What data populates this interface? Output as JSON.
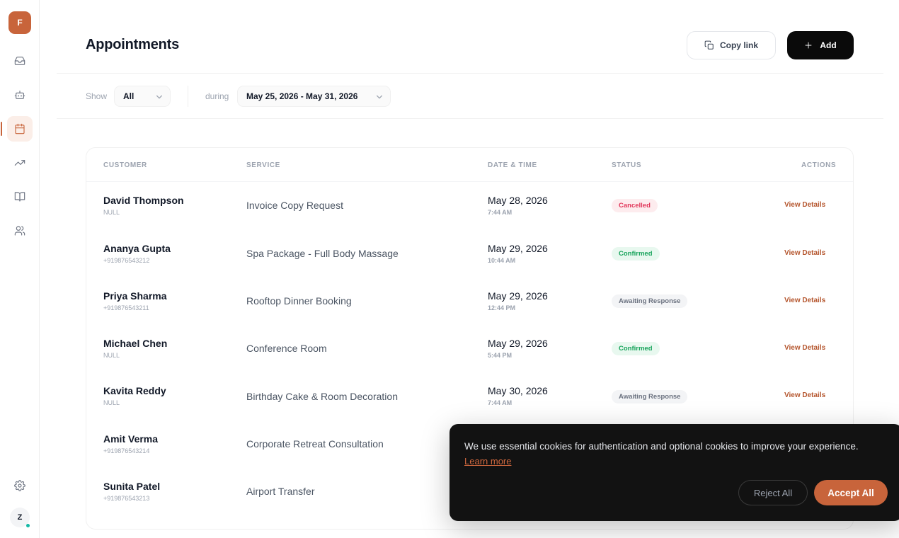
{
  "sidebar": {
    "logo_letter": "F",
    "items": [
      {
        "name": "inbox",
        "icon": "inbox-icon"
      },
      {
        "name": "bot",
        "icon": "bot-icon"
      },
      {
        "name": "appointments",
        "icon": "calendar-icon",
        "active": true
      },
      {
        "name": "analytics",
        "icon": "trending-up-icon"
      },
      {
        "name": "knowledge",
        "icon": "book-icon"
      },
      {
        "name": "users",
        "icon": "users-icon"
      }
    ],
    "settings_icon": "gear-icon",
    "user_initial": "Z"
  },
  "header": {
    "title": "Appointments",
    "copy_link_label": "Copy link",
    "add_label": "Add"
  },
  "filters": {
    "show_label": "Show",
    "show_value": "All",
    "during_label": "during",
    "date_range": "May 25, 2026 - May 31, 2026"
  },
  "table": {
    "columns": [
      "CUSTOMER",
      "SERVICE",
      "DATE & TIME",
      "STATUS",
      "ACTIONS"
    ],
    "rows": [
      {
        "name": "David Thompson",
        "phone": "NULL",
        "service": "Invoice Copy Request",
        "date": "May 28, 2026",
        "time": "7:44 AM",
        "status": "Cancelled",
        "status_type": "cancelled",
        "action": "View Details"
      },
      {
        "name": "Ananya Gupta",
        "phone": "+919876543212",
        "service": "Spa Package - Full Body Massage",
        "date": "May 29, 2026",
        "time": "10:44 AM",
        "status": "Confirmed",
        "status_type": "confirmed",
        "action": "View Details"
      },
      {
        "name": "Priya Sharma",
        "phone": "+919876543211",
        "service": "Rooftop Dinner Booking",
        "date": "May 29, 2026",
        "time": "12:44 PM",
        "status": "Awaiting Response",
        "status_type": "awaiting",
        "action": "View Details"
      },
      {
        "name": "Michael Chen",
        "phone": "NULL",
        "service": "Conference Room",
        "date": "May 29, 2026",
        "time": "5:44 PM",
        "status": "Confirmed",
        "status_type": "confirmed",
        "action": "View Details"
      },
      {
        "name": "Kavita Reddy",
        "phone": "NULL",
        "service": "Birthday Cake & Room Decoration",
        "date": "May 30, 2026",
        "time": "7:44 AM",
        "status": "Awaiting Response",
        "status_type": "awaiting",
        "action": "View Details"
      },
      {
        "name": "Amit Verma",
        "phone": "+919876543214",
        "service": "Corporate Retreat Consultation"
      },
      {
        "name": "Sunita Patel",
        "phone": "+919876543213",
        "service": "Airport Transfer"
      }
    ]
  },
  "cookie_banner": {
    "message": "We use essential cookies for authentication and optional cookies to improve your experience.",
    "learn_more": "Learn more",
    "reject_label": "Reject All",
    "accept_label": "Accept All"
  },
  "colors": {
    "accent": "#c8643b",
    "primary_button": "#0a0a0a",
    "cancelled": "#e1375a",
    "confirmed": "#16a35a",
    "awaiting": "#6b7280"
  }
}
